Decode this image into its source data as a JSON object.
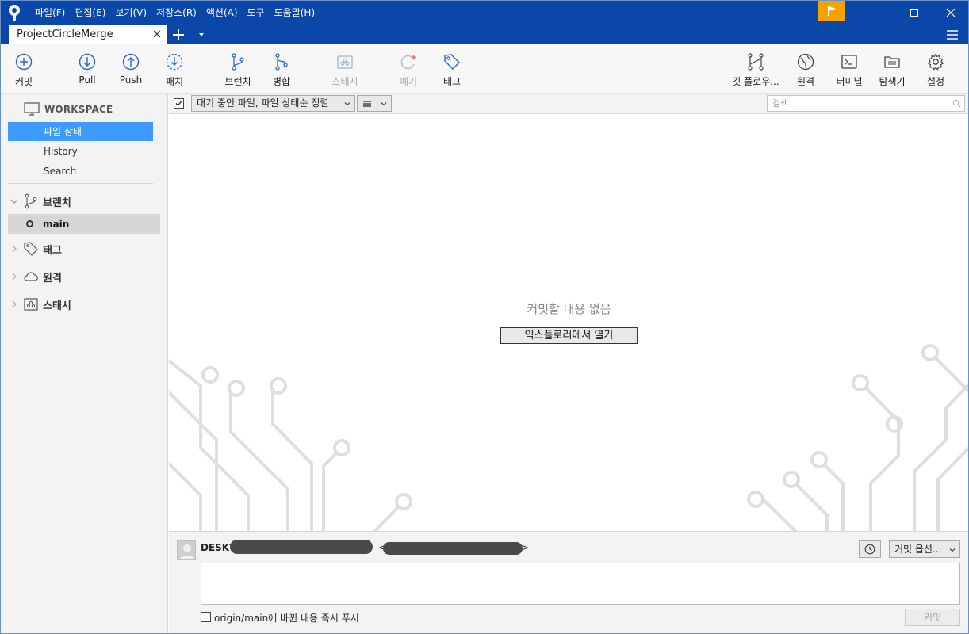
{
  "window": {
    "menu": [
      "파일(F)",
      "편집(E)",
      "보기(V)",
      "저장소(R)",
      "액션(A)",
      "도구",
      "도움말(H)"
    ],
    "tab_title": "ProjectCircleMerge",
    "colors": {
      "titlebar": "#0b47a8",
      "accent": "#3d9bff",
      "flag": "#f5a300"
    }
  },
  "toolbar": {
    "left": [
      {
        "label": "커밋",
        "icon": "plus-circle-icon",
        "enabled": true
      },
      {
        "label": "Pull",
        "icon": "arrow-down-circle-icon",
        "enabled": true
      },
      {
        "label": "Push",
        "icon": "arrow-up-circle-icon",
        "enabled": true
      },
      {
        "label": "패치",
        "icon": "patch-download-icon",
        "enabled": true
      },
      {
        "label": "브랜치",
        "icon": "branch-icon",
        "enabled": true
      },
      {
        "label": "병합",
        "icon": "merge-icon",
        "enabled": true
      },
      {
        "label": "스태시",
        "icon": "stash-icon",
        "enabled": false
      },
      {
        "label": "폐기",
        "icon": "discard-icon",
        "enabled": false
      },
      {
        "label": "태그",
        "icon": "tag-icon",
        "enabled": true
      }
    ],
    "right": [
      {
        "label": "깃 플로우...",
        "icon": "git-flow-icon"
      },
      {
        "label": "원격",
        "icon": "globe-icon"
      },
      {
        "label": "터미널",
        "icon": "terminal-icon"
      },
      {
        "label": "탐색기",
        "icon": "folder-icon"
      },
      {
        "label": "설정",
        "icon": "gear-icon"
      }
    ]
  },
  "sidebar": {
    "workspace": "WORKSPACE",
    "workspace_items": [
      "파일 상태",
      "History",
      "Search"
    ],
    "selected_item": "파일 상태",
    "branches_label": "브랜치",
    "current_branch": "main",
    "tags_label": "태그",
    "remotes_label": "원격",
    "stashes_label": "스태시"
  },
  "filter": {
    "sort_option": "대기 중인 파일, 파일 상태순 정렬",
    "search_placeholder": "검색"
  },
  "main": {
    "empty_message": "커밋할 내용 없음",
    "open_explorer": "익스플로러에서 열기"
  },
  "commit": {
    "author_prefix": "DESKT",
    "email_open": "<",
    "email_close": ">",
    "options_label": "커밋 옵션...",
    "push_label": "origin/main에 바뀐 내용 즉시 푸시",
    "commit_button": "커밋"
  }
}
